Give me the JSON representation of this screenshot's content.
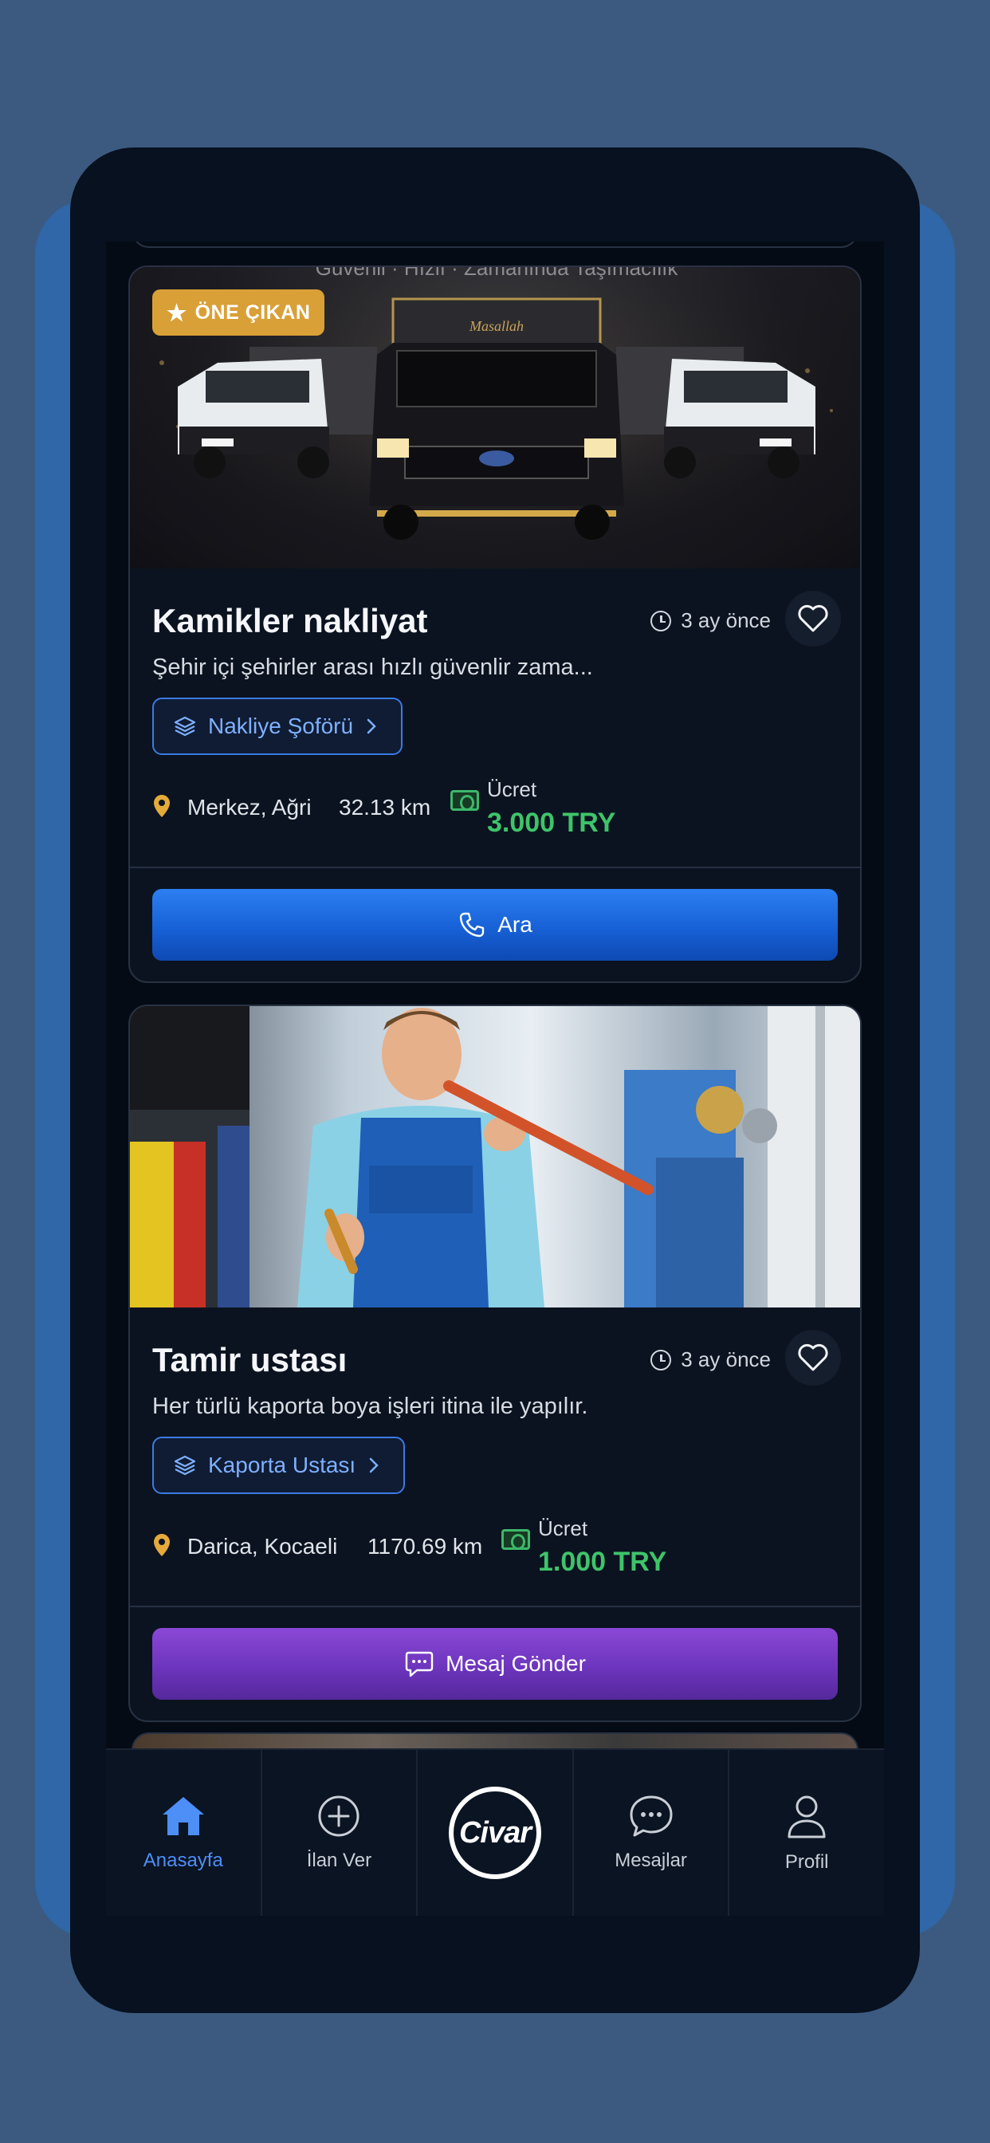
{
  "feed": {
    "cards": [
      {
        "image_alt": "Güvenli · Hızlı · Zamanında Taşımacılık",
        "badge": "ÖNE ÇIKAN",
        "title": "Kamikler nakliyat",
        "time": "3 ay önce",
        "description": "Şehir içi şehirler arası hızlı güvenlir zama...",
        "category": "Nakliye Şoförü",
        "location": "Merkez, Ağri",
        "distance": "32.13 km",
        "price_label": "Ücret",
        "price": "3.000 TRY",
        "action": "Ara"
      },
      {
        "title": "Tamir ustası",
        "time": "3 ay önce",
        "description": "Her türlü kaporta boya işleri itina ile yapılır.",
        "category": "Kaporta Ustası",
        "location": "Darica, Kocaeli",
        "distance": "1170.69 km",
        "price_label": "Ücret",
        "price": "1.000 TRY",
        "action": "Mesaj Gönder"
      }
    ]
  },
  "tabbar": {
    "home": "Anasayfa",
    "post": "İlan Ver",
    "brand": "Civar",
    "messages": "Mesajlar",
    "profile": "Profil"
  },
  "colors": {
    "accent_blue": "#2c7ff2",
    "accent_purple": "#7a3fcb",
    "price_green": "#3ec46a",
    "badge_gold": "#d9a037"
  }
}
